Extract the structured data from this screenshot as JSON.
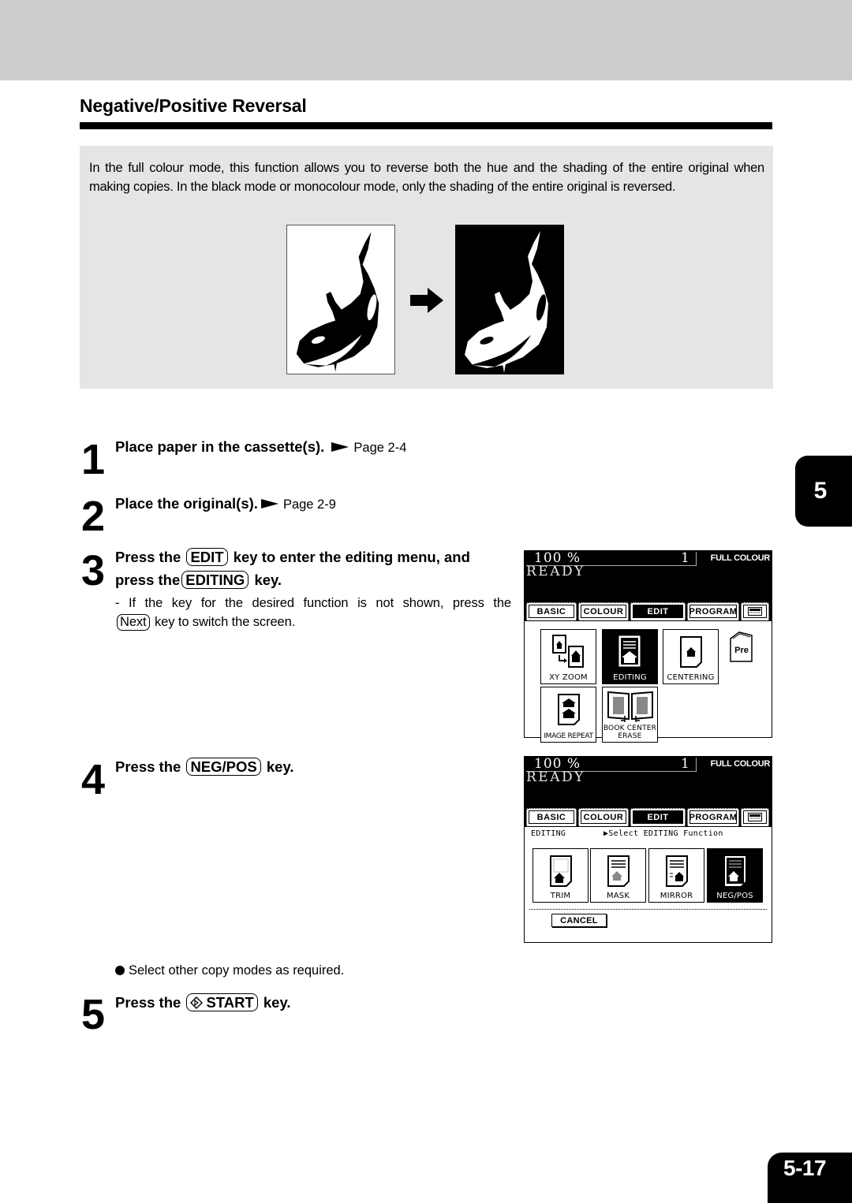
{
  "section": {
    "title": "Negative/Positive Reversal"
  },
  "intro": {
    "text": "In the full colour mode, this function allows you to reverse both the hue and the shading of the entire original when making copies.  In the black mode or monocolour mode, only the shading of the entire original is reversed.",
    "illustration": {
      "original_label": "orca-positive-image",
      "reversed_label": "orca-negative-image",
      "arrow_icon": "arrow-right-icon"
    }
  },
  "steps": [
    {
      "number": "1",
      "text": "Place paper in the cassette(s).",
      "ref": "Page 2-4"
    },
    {
      "number": "2",
      "text": "Place the original(s).",
      "ref": "Page 2-9"
    },
    {
      "number": "3",
      "text_a": "Press the",
      "key_a": "EDIT",
      "text_b": "key to enter the editing menu, and",
      "text_c": "press the",
      "key_b": "EDITING",
      "text_d": "key.",
      "note_a": "- If the key for the desired function is not shown, press the",
      "note_key": "Next",
      "note_b": "key to switch the screen."
    },
    {
      "number": "4",
      "text_a": "Press the",
      "key": "NEG/POS",
      "text_b": "key."
    },
    {
      "number": "5",
      "text_a": "Press the",
      "key": "START",
      "key_icon": "start-diamond-icon",
      "text_b": "key."
    }
  ],
  "bullet": "Select other copy modes as required.",
  "lcd1": {
    "zoom": "100  %",
    "count": "1",
    "mode": "FULL COLOUR",
    "status": "READY",
    "tabs": [
      "BASIC",
      "COLOUR",
      "EDIT",
      "PROGRAM"
    ],
    "active_tab": "EDIT",
    "menu_icon": "menu-screen-icon",
    "functions": [
      {
        "label": "XY ZOOM",
        "selected": false
      },
      {
        "label": "EDITING",
        "selected": true
      },
      {
        "label": "CENTERING",
        "selected": false
      },
      {
        "label": "IMAGE REPEAT",
        "selected": false
      },
      {
        "label": "BOOK CENTER",
        "label2": "ERASE",
        "selected": false
      }
    ],
    "pre_label": "Pre"
  },
  "lcd2": {
    "zoom": "100  %",
    "count": "1",
    "mode": "FULL COLOUR",
    "status": "READY",
    "tabs": [
      "BASIC",
      "COLOUR",
      "EDIT",
      "PROGRAM"
    ],
    "active_tab": "EDIT",
    "hint_left": "EDITING",
    "hint_right": "▶Select EDITING Function",
    "functions": [
      {
        "label": "TRIM",
        "selected": false
      },
      {
        "label": "MASK",
        "selected": false
      },
      {
        "label": "MIRROR",
        "selected": false
      },
      {
        "label": "NEG/POS",
        "selected": true
      }
    ],
    "cancel": "CANCEL"
  },
  "chapter_tab": "5",
  "page_number": "5-17"
}
